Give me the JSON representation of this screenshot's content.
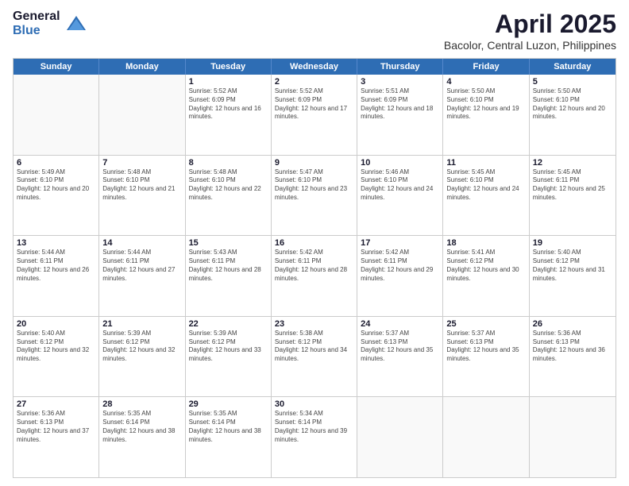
{
  "header": {
    "logo_general": "General",
    "logo_blue": "Blue",
    "title": "April 2025",
    "subtitle": "Bacolor, Central Luzon, Philippines"
  },
  "days_of_week": [
    "Sunday",
    "Monday",
    "Tuesday",
    "Wednesday",
    "Thursday",
    "Friday",
    "Saturday"
  ],
  "weeks": [
    [
      {
        "day": "",
        "info": ""
      },
      {
        "day": "",
        "info": ""
      },
      {
        "day": "1",
        "info": "Sunrise: 5:52 AM\nSunset: 6:09 PM\nDaylight: 12 hours and 16 minutes."
      },
      {
        "day": "2",
        "info": "Sunrise: 5:52 AM\nSunset: 6:09 PM\nDaylight: 12 hours and 17 minutes."
      },
      {
        "day": "3",
        "info": "Sunrise: 5:51 AM\nSunset: 6:09 PM\nDaylight: 12 hours and 18 minutes."
      },
      {
        "day": "4",
        "info": "Sunrise: 5:50 AM\nSunset: 6:10 PM\nDaylight: 12 hours and 19 minutes."
      },
      {
        "day": "5",
        "info": "Sunrise: 5:50 AM\nSunset: 6:10 PM\nDaylight: 12 hours and 20 minutes."
      }
    ],
    [
      {
        "day": "6",
        "info": "Sunrise: 5:49 AM\nSunset: 6:10 PM\nDaylight: 12 hours and 20 minutes."
      },
      {
        "day": "7",
        "info": "Sunrise: 5:48 AM\nSunset: 6:10 PM\nDaylight: 12 hours and 21 minutes."
      },
      {
        "day": "8",
        "info": "Sunrise: 5:48 AM\nSunset: 6:10 PM\nDaylight: 12 hours and 22 minutes."
      },
      {
        "day": "9",
        "info": "Sunrise: 5:47 AM\nSunset: 6:10 PM\nDaylight: 12 hours and 23 minutes."
      },
      {
        "day": "10",
        "info": "Sunrise: 5:46 AM\nSunset: 6:10 PM\nDaylight: 12 hours and 24 minutes."
      },
      {
        "day": "11",
        "info": "Sunrise: 5:45 AM\nSunset: 6:10 PM\nDaylight: 12 hours and 24 minutes."
      },
      {
        "day": "12",
        "info": "Sunrise: 5:45 AM\nSunset: 6:11 PM\nDaylight: 12 hours and 25 minutes."
      }
    ],
    [
      {
        "day": "13",
        "info": "Sunrise: 5:44 AM\nSunset: 6:11 PM\nDaylight: 12 hours and 26 minutes."
      },
      {
        "day": "14",
        "info": "Sunrise: 5:44 AM\nSunset: 6:11 PM\nDaylight: 12 hours and 27 minutes."
      },
      {
        "day": "15",
        "info": "Sunrise: 5:43 AM\nSunset: 6:11 PM\nDaylight: 12 hours and 28 minutes."
      },
      {
        "day": "16",
        "info": "Sunrise: 5:42 AM\nSunset: 6:11 PM\nDaylight: 12 hours and 28 minutes."
      },
      {
        "day": "17",
        "info": "Sunrise: 5:42 AM\nSunset: 6:11 PM\nDaylight: 12 hours and 29 minutes."
      },
      {
        "day": "18",
        "info": "Sunrise: 5:41 AM\nSunset: 6:12 PM\nDaylight: 12 hours and 30 minutes."
      },
      {
        "day": "19",
        "info": "Sunrise: 5:40 AM\nSunset: 6:12 PM\nDaylight: 12 hours and 31 minutes."
      }
    ],
    [
      {
        "day": "20",
        "info": "Sunrise: 5:40 AM\nSunset: 6:12 PM\nDaylight: 12 hours and 32 minutes."
      },
      {
        "day": "21",
        "info": "Sunrise: 5:39 AM\nSunset: 6:12 PM\nDaylight: 12 hours and 32 minutes."
      },
      {
        "day": "22",
        "info": "Sunrise: 5:39 AM\nSunset: 6:12 PM\nDaylight: 12 hours and 33 minutes."
      },
      {
        "day": "23",
        "info": "Sunrise: 5:38 AM\nSunset: 6:12 PM\nDaylight: 12 hours and 34 minutes."
      },
      {
        "day": "24",
        "info": "Sunrise: 5:37 AM\nSunset: 6:13 PM\nDaylight: 12 hours and 35 minutes."
      },
      {
        "day": "25",
        "info": "Sunrise: 5:37 AM\nSunset: 6:13 PM\nDaylight: 12 hours and 35 minutes."
      },
      {
        "day": "26",
        "info": "Sunrise: 5:36 AM\nSunset: 6:13 PM\nDaylight: 12 hours and 36 minutes."
      }
    ],
    [
      {
        "day": "27",
        "info": "Sunrise: 5:36 AM\nSunset: 6:13 PM\nDaylight: 12 hours and 37 minutes."
      },
      {
        "day": "28",
        "info": "Sunrise: 5:35 AM\nSunset: 6:14 PM\nDaylight: 12 hours and 38 minutes."
      },
      {
        "day": "29",
        "info": "Sunrise: 5:35 AM\nSunset: 6:14 PM\nDaylight: 12 hours and 38 minutes."
      },
      {
        "day": "30",
        "info": "Sunrise: 5:34 AM\nSunset: 6:14 PM\nDaylight: 12 hours and 39 minutes."
      },
      {
        "day": "",
        "info": ""
      },
      {
        "day": "",
        "info": ""
      },
      {
        "day": "",
        "info": ""
      }
    ]
  ]
}
